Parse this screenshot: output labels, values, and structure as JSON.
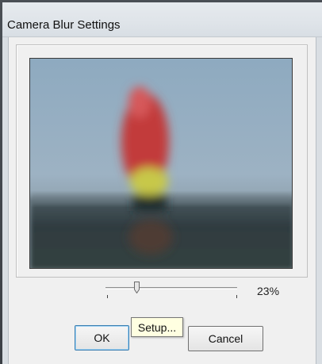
{
  "window": {
    "title": "Camera Blur Settings"
  },
  "slider": {
    "value_percent": 23,
    "label": "23%"
  },
  "buttons": {
    "ok_label": "OK",
    "cancel_label": "Cancel"
  },
  "tooltip": {
    "text": "Setup..."
  },
  "colors": {
    "sky": "#7b9bb5",
    "sail_red": "#c23b3b",
    "sea": "#2f3a3e",
    "tooltip_bg": "#ffffe1"
  }
}
